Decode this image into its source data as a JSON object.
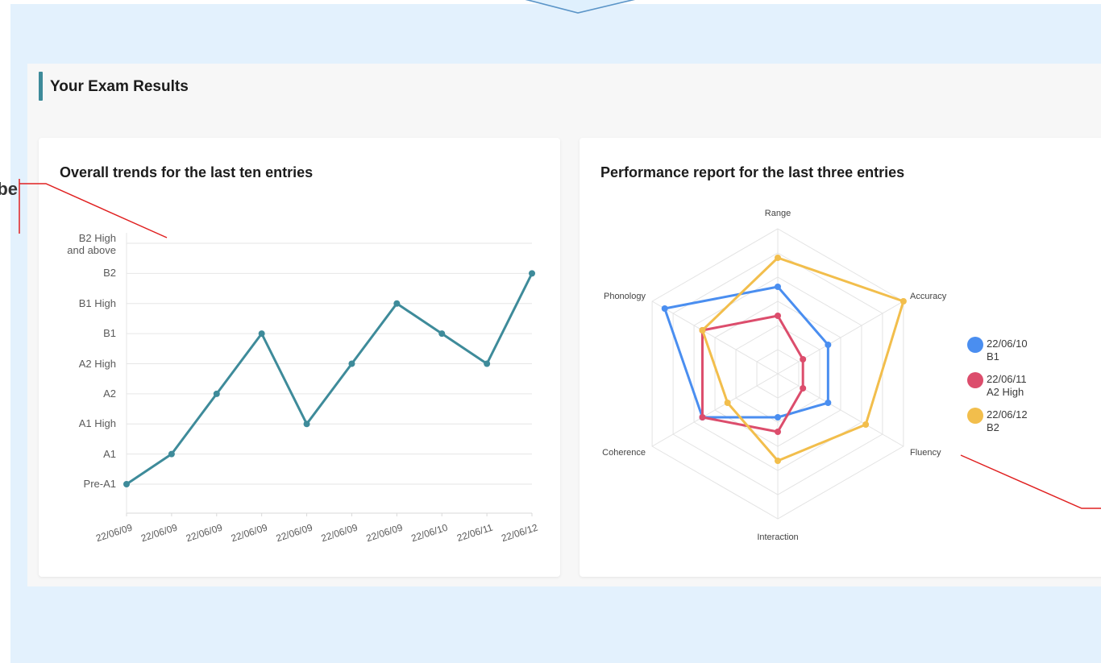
{
  "section": {
    "title": "Your Exam Results"
  },
  "cut_label": "be",
  "trends": {
    "title": "Overall trends for the last ten entries"
  },
  "performance": {
    "title": "Performance report for the last three entries"
  },
  "colors": {
    "accent": "#3e8b9a",
    "background": "#e3f1fd",
    "series_blue": "#4a8ef0",
    "series_red": "#dc4d6c",
    "series_yellow": "#f2be4c",
    "annotation_red": "#e02020"
  },
  "chart_data": [
    {
      "type": "line",
      "title": "Overall trends for the last ten entries",
      "x": [
        "22/06/09",
        "22/06/09",
        "22/06/09",
        "22/06/09",
        "22/06/09",
        "22/06/09",
        "22/06/09",
        "22/06/10",
        "22/06/11",
        "22/06/12"
      ],
      "y_levels": [
        "Pre-A1",
        "A1",
        "A1 High",
        "A2",
        "A2 High",
        "B1",
        "B1 High",
        "B2",
        "B2 High and above"
      ],
      "y_level_lines": [
        [
          "Pre-A1"
        ],
        [
          "A1"
        ],
        [
          "A1 High"
        ],
        [
          "A2"
        ],
        [
          "A2 High"
        ],
        [
          "B1"
        ],
        [
          "B1 High"
        ],
        [
          "B2"
        ],
        [
          "B2 High",
          "and above"
        ]
      ],
      "values": [
        "Pre-A1",
        "A1",
        "A2",
        "B1",
        "A1 High",
        "A2 High",
        "B1 High",
        "B1",
        "A2 High",
        "B2"
      ],
      "grid": true
    },
    {
      "type": "radar",
      "title": "Performance report for the last three entries",
      "axes": [
        "Range",
        "Accuracy",
        "Fluency",
        "Interaction",
        "Coherence",
        "Phonology"
      ],
      "max": 10,
      "legend_position": "right",
      "series": [
        {
          "name": "22/06/10",
          "level": "B1",
          "color": "#4a8ef0",
          "values": [
            6,
            4,
            4,
            3,
            6,
            9
          ]
        },
        {
          "name": "22/06/11",
          "level": "A2 High",
          "color": "#dc4d6c",
          "values": [
            4,
            2,
            2,
            4,
            6,
            6
          ]
        },
        {
          "name": "22/06/12",
          "level": "B2",
          "color": "#f2be4c",
          "values": [
            8,
            10,
            7,
            6,
            4,
            6
          ]
        }
      ]
    }
  ]
}
